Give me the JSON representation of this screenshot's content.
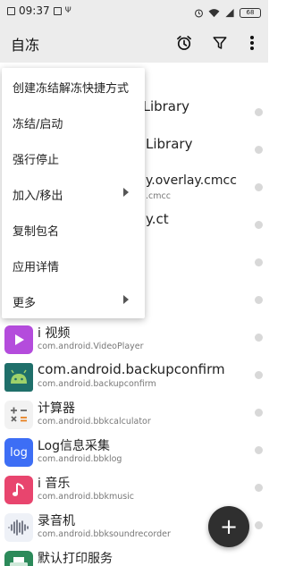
{
  "status_bar": {
    "time": "09:37",
    "battery": "68"
  },
  "app_bar": {
    "title": "自冻",
    "icons": [
      "alarm-clock-icon",
      "filter-icon",
      "more-vert-icon"
    ]
  },
  "background_rows": [
    {
      "name_fragment": "s Library"
    },
    {
      "name_fragment": "Library"
    },
    {
      "name_fragment": "y.overlay.cmcc",
      "pkg_fragment": ".cmcc"
    },
    {
      "name_fragment": "y.ct"
    }
  ],
  "menu": {
    "items": [
      {
        "label": "创建冻结解冻快捷方式",
        "submenu": false
      },
      {
        "label": "冻结/启动",
        "submenu": false
      },
      {
        "label": "强行停止",
        "submenu": false
      },
      {
        "label": "加入/移出",
        "submenu": true
      },
      {
        "label": "复制包名",
        "submenu": false
      },
      {
        "label": "应用详情",
        "submenu": false
      },
      {
        "label": "更多",
        "submenu": true
      }
    ]
  },
  "apps": [
    {
      "name": "i 视频",
      "package": "com.android.VideoPlayer",
      "icon": "video-player-icon",
      "color": "#b44cdc"
    },
    {
      "name": "com.android.backupconfirm",
      "package": "com.android.backupconfirm",
      "icon": "android-robot-icon",
      "color": "#1f6f6a"
    },
    {
      "name": "计算器",
      "package": "com.android.bbkcalculator",
      "icon": "calculator-icon",
      "color": "#f2f2f2"
    },
    {
      "name": "Log信息采集",
      "package": "com.android.bbklog",
      "icon": "log-icon",
      "color": "#3d6ef5"
    },
    {
      "name": "i 音乐",
      "package": "com.android.bbkmusic",
      "icon": "music-note-icon",
      "color": "#e8456e"
    },
    {
      "name": "录音机",
      "package": "com.android.bbksoundrecorder",
      "icon": "sound-wave-icon",
      "color": "#eef1f7"
    },
    {
      "name": "默认打印服务",
      "package": "",
      "icon": "printer-icon",
      "color": "#2c8a5a"
    }
  ],
  "fab": {
    "label": "+"
  }
}
